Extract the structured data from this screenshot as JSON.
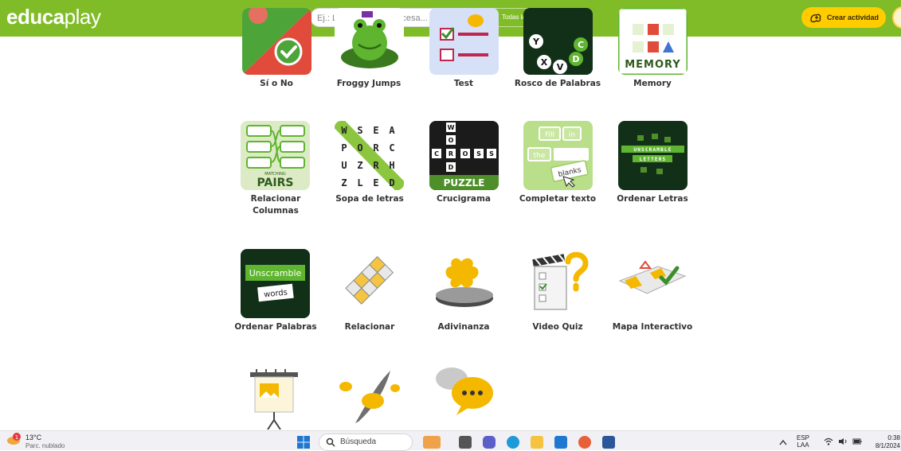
{
  "header": {
    "logo_bold": "educa",
    "logo_thin": "play",
    "search_placeholder": "Ej.: La revolución francesa...",
    "filter_label": "Todas las actividades",
    "create_label": "Crear actividad",
    "colors": {
      "brand_green": "#80bc27",
      "accent_yellow": "#ffcc00"
    }
  },
  "activities": [
    {
      "id": "si-no",
      "label": "Sí o No",
      "icon": "yes-no-icon"
    },
    {
      "id": "froggy",
      "label": "Froggy Jumps",
      "icon": "frog-icon"
    },
    {
      "id": "test",
      "label": "Test",
      "icon": "checklist-icon"
    },
    {
      "id": "rosco",
      "label": "Rosco de Palabras",
      "icon": "letter-wheel-icon",
      "tile_text": [
        "Y",
        "C",
        "X",
        "V",
        "D"
      ]
    },
    {
      "id": "memory",
      "label": "Memory",
      "icon": "memory-cards-icon",
      "tile_text": "MEMORY"
    },
    {
      "id": "pairs",
      "label": "Relacionar Columnas",
      "icon": "matching-pairs-icon",
      "tile_text": "PAIRS",
      "tile_subtext": "MATCHING"
    },
    {
      "id": "sopa",
      "label": "Sopa de letras",
      "icon": "word-search-icon",
      "grid": [
        "WSEA",
        "PORC",
        "UZRH",
        "ZLED"
      ]
    },
    {
      "id": "cruci",
      "label": "Crucigrama",
      "icon": "crossword-icon",
      "tile_text": "PUZZLE",
      "down": [
        "W",
        "O",
        "R",
        "D"
      ],
      "across": [
        "C",
        "R",
        "O",
        "S",
        "S"
      ]
    },
    {
      "id": "completar",
      "label": "Completar texto",
      "icon": "fill-in-blanks-icon",
      "words": [
        "Fill",
        "in",
        "the",
        "blanks"
      ]
    },
    {
      "id": "ordenar-letras",
      "label": "Ordenar Letras",
      "icon": "unscramble-letters-icon",
      "tile_text": [
        "UNSCRAMBLE",
        "LETTERS"
      ]
    },
    {
      "id": "ordenar-palabras",
      "label": "Ordenar Palabras",
      "icon": "unscramble-words-icon",
      "tile_text": "Unscramble",
      "tile_subtext": "words"
    },
    {
      "id": "relacionar",
      "label": "Relacionar",
      "icon": "abc-blocks-icon"
    },
    {
      "id": "adivinanza",
      "label": "Adivinanza",
      "icon": "puzzle-piece-icon"
    },
    {
      "id": "video-quiz",
      "label": "Video Quiz",
      "icon": "clapper-question-icon"
    },
    {
      "id": "mapa",
      "label": "Mapa Interactivo",
      "icon": "interactive-map-icon"
    },
    {
      "id": "presentacion",
      "label": "",
      "icon": "presentation-board-icon"
    },
    {
      "id": "dictado",
      "label": "",
      "icon": "quill-speech-icon"
    },
    {
      "id": "dialogo",
      "label": "",
      "icon": "speech-bubbles-icon"
    }
  ],
  "taskbar": {
    "weather_temp": "13°C",
    "weather_desc": "Parc. nublado",
    "weather_badge": "1",
    "search_label": "Búsqueda",
    "lang": "ESP",
    "lang_sub": "LAA",
    "clock_time": "0:38",
    "clock_date": "8/1/2024"
  }
}
